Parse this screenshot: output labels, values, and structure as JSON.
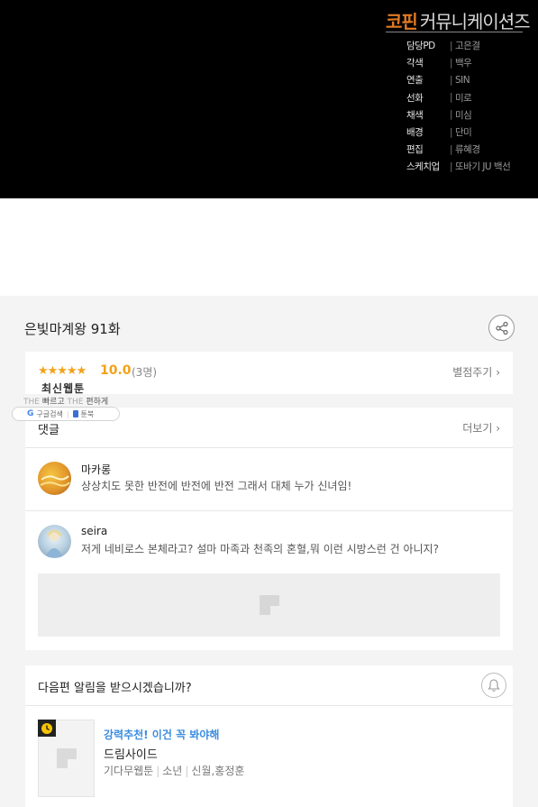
{
  "banner": {
    "studio_part1": "코핀",
    "studio_part2": "커뮤니케이션즈",
    "credits": [
      {
        "role": "담당PD",
        "name": "고은결"
      },
      {
        "role": "각색",
        "name": "백우"
      },
      {
        "role": "연출",
        "name": "SIN"
      },
      {
        "role": "선화",
        "name": "미로"
      },
      {
        "role": "채색",
        "name": "미심"
      },
      {
        "role": "배경",
        "name": "단미"
      },
      {
        "role": "편집",
        "name": "류혜경"
      },
      {
        "role": "스케치업",
        "name": "또바기  JU  백선"
      }
    ]
  },
  "episode": {
    "title": "은빛마계왕 91화"
  },
  "rating": {
    "stars": "★★★★★",
    "score": "10.0",
    "count": "(3명)",
    "rate_link": "별점주기",
    "subtitle": "최신웹툰"
  },
  "overlay": {
    "the1": "THE",
    "fast": "빠르고",
    "the2": "THE",
    "easy": "편하게",
    "google": "G",
    "google_label": "구글검색",
    "book_label": "툰북"
  },
  "comments": {
    "title": "댓글",
    "more": "더보기",
    "items": [
      {
        "user": "마카롱",
        "text": "상상치도 못한 반전에 반전에 반전 그래서 대체 누가 신녀임!"
      },
      {
        "user": "seira",
        "text": "저게 네비로스 본체라고? 설마 마족과 천족의 혼혈,뭐 이런 시방스런 건 아니지?"
      }
    ]
  },
  "notify": {
    "question": "다음편 알림을 받으시겠습니까?"
  },
  "recommend": {
    "tag": "강력추천! 이건 꼭 봐야해",
    "title": "드림사이드",
    "meta": [
      "기다무웹툰",
      "소년",
      "신월,홍정훈"
    ]
  },
  "colors": {
    "accent_orange": "#f2a21a",
    "studio_orange": "#e07a22",
    "link_blue": "#3b8de0"
  }
}
